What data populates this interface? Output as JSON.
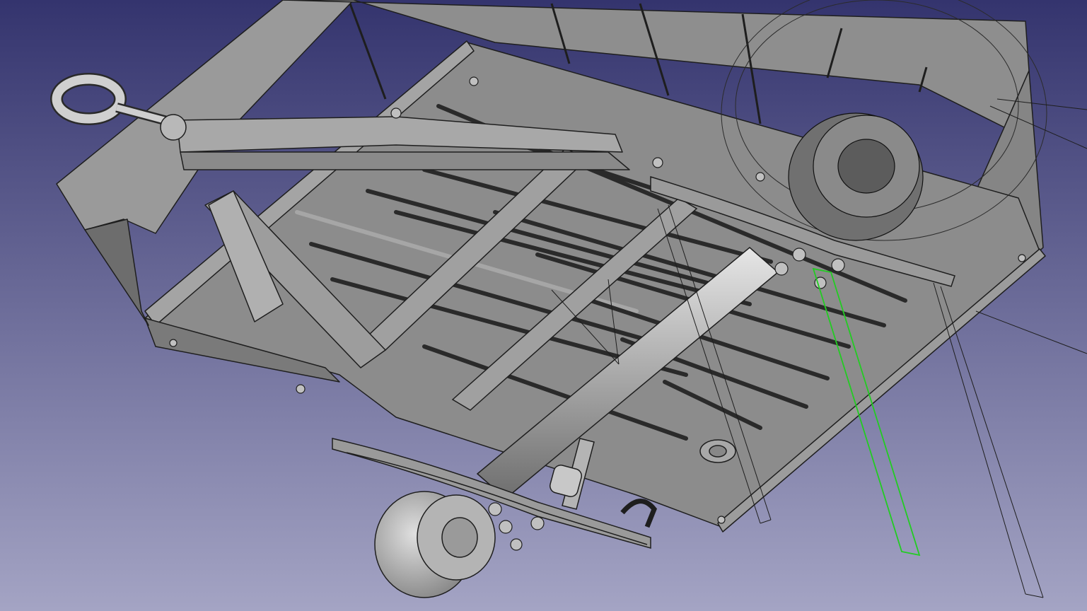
{
  "viewport": {
    "background_top": "#34346e",
    "background_bottom": "#a4a4c4"
  },
  "colors": {
    "body_fill": "#8c8c8c",
    "body_light": "#a8a8a8",
    "body_dark": "#6a6a6a",
    "edge": "#1e1e1e",
    "selection": "#22cc22",
    "metal_highlight": "#d8d8d8"
  },
  "icons": {
    "tow_eye": "tow-eye-icon"
  }
}
